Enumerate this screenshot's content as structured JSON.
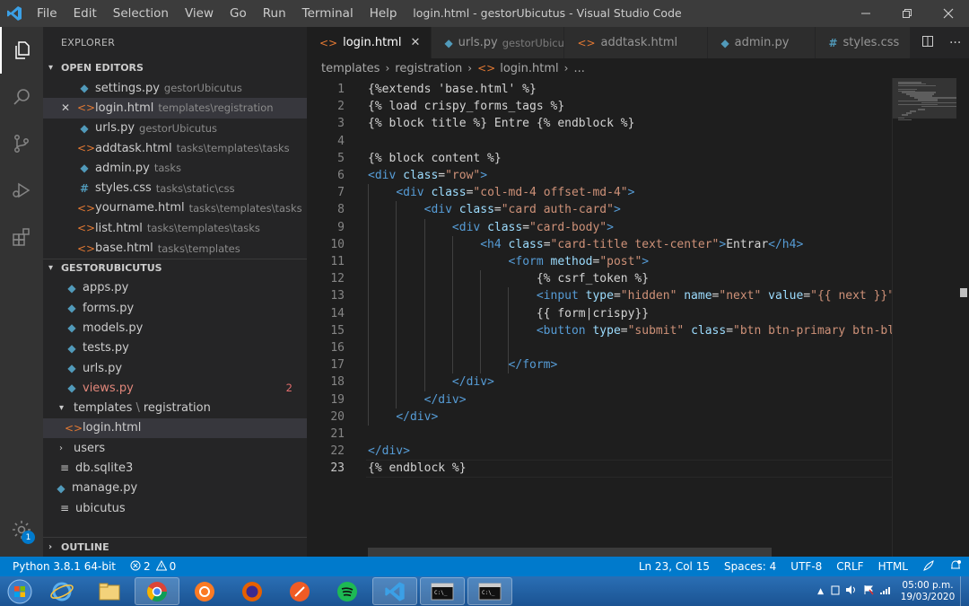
{
  "window": {
    "title": "login.html - gestorUbicutus - Visual Studio Code",
    "menu": [
      "File",
      "Edit",
      "Selection",
      "View",
      "Go",
      "Run",
      "Terminal",
      "Help"
    ]
  },
  "sidebar": {
    "title": "EXPLORER",
    "open_editors_label": "OPEN EDITORS",
    "open_editors": [
      {
        "name": "settings.py",
        "desc": "gestorUbicutus",
        "type": "py"
      },
      {
        "name": "login.html",
        "desc": "templates\\registration",
        "type": "html",
        "active": true
      },
      {
        "name": "urls.py",
        "desc": "gestorUbicutus",
        "type": "py"
      },
      {
        "name": "addtask.html",
        "desc": "tasks\\templates\\tasks",
        "type": "html"
      },
      {
        "name": "admin.py",
        "desc": "tasks",
        "type": "py"
      },
      {
        "name": "styles.css",
        "desc": "tasks\\static\\css",
        "type": "css"
      },
      {
        "name": "yourname.html",
        "desc": "tasks\\templates\\tasks",
        "type": "html"
      },
      {
        "name": "list.html",
        "desc": "tasks\\templates\\tasks",
        "type": "html"
      },
      {
        "name": "base.html",
        "desc": "tasks\\templates",
        "type": "html"
      }
    ],
    "project_label": "GESTORUBICUTUS",
    "tree": {
      "apps": "apps.py",
      "forms": "forms.py",
      "models": "models.py",
      "tests": "tests.py",
      "urls": "urls.py",
      "views": "views.py",
      "views_count": "2",
      "templates_a": "templates",
      "templates_b": "registration",
      "login": "login.html",
      "users": "users",
      "db": "db.sqlite3",
      "manage": "manage.py",
      "ubicutus": "ubicutus"
    },
    "outline_label": "OUTLINE"
  },
  "tabs": [
    {
      "name": "login.html",
      "desc": "",
      "type": "html",
      "active": true
    },
    {
      "name": "urls.py",
      "desc": "gestorUbicutus",
      "type": "py"
    },
    {
      "name": "addtask.html",
      "desc": "",
      "type": "html"
    },
    {
      "name": "admin.py",
      "desc": "",
      "type": "py"
    },
    {
      "name": "styles.css",
      "desc": "",
      "type": "css"
    }
  ],
  "breadcrumb": [
    "templates",
    "registration",
    "login.html",
    "..."
  ],
  "editor": {
    "lines": [
      {
        "n": "1",
        "segs": [
          [
            "tx",
            "{%extends 'base.html' %}"
          ]
        ]
      },
      {
        "n": "2",
        "segs": [
          [
            "tx",
            "{% load crispy_forms_tags %}"
          ]
        ]
      },
      {
        "n": "3",
        "segs": [
          [
            "tx",
            "{% block title %} Entre {% endblock %}"
          ]
        ]
      },
      {
        "n": "4",
        "segs": []
      },
      {
        "n": "5",
        "segs": [
          [
            "tx",
            "{% block content %}"
          ]
        ]
      },
      {
        "n": "6",
        "segs": [
          [
            "tg",
            "<div "
          ],
          [
            "at",
            "class"
          ],
          [
            "tx",
            "="
          ],
          [
            "sv",
            "\"row\""
          ],
          [
            "tg",
            ">"
          ]
        ]
      },
      {
        "n": "7",
        "segs": [
          [
            "tx",
            "    "
          ],
          [
            "tg",
            "<div "
          ],
          [
            "at",
            "class"
          ],
          [
            "tx",
            "="
          ],
          [
            "sv",
            "\"col-md-4 offset-md-4\""
          ],
          [
            "tg",
            ">"
          ]
        ]
      },
      {
        "n": "8",
        "segs": [
          [
            "tx",
            "        "
          ],
          [
            "tg",
            "<div "
          ],
          [
            "at",
            "class"
          ],
          [
            "tx",
            "="
          ],
          [
            "sv",
            "\"card auth-card\""
          ],
          [
            "tg",
            ">"
          ]
        ]
      },
      {
        "n": "9",
        "segs": [
          [
            "tx",
            "            "
          ],
          [
            "tg",
            "<div "
          ],
          [
            "at",
            "class"
          ],
          [
            "tx",
            "="
          ],
          [
            "sv",
            "\"card-body\""
          ],
          [
            "tg",
            ">"
          ]
        ]
      },
      {
        "n": "10",
        "segs": [
          [
            "tx",
            "                "
          ],
          [
            "tg",
            "<h4 "
          ],
          [
            "at",
            "class"
          ],
          [
            "tx",
            "="
          ],
          [
            "sv",
            "\"card-title text-center\""
          ],
          [
            "tg",
            ">"
          ],
          [
            "tx",
            "Entrar"
          ],
          [
            "tg",
            "</h4>"
          ]
        ]
      },
      {
        "n": "11",
        "segs": [
          [
            "tx",
            "                    "
          ],
          [
            "tg",
            "<form "
          ],
          [
            "at",
            "method"
          ],
          [
            "tx",
            "="
          ],
          [
            "sv",
            "\"post\""
          ],
          [
            "tg",
            ">"
          ]
        ]
      },
      {
        "n": "12",
        "segs": [
          [
            "tx",
            "                        {% csrf_token %}"
          ]
        ]
      },
      {
        "n": "13",
        "segs": [
          [
            "tx",
            "                        "
          ],
          [
            "tg",
            "<input "
          ],
          [
            "at",
            "type"
          ],
          [
            "tx",
            "="
          ],
          [
            "sv",
            "\"hidden\""
          ],
          [
            "tx",
            " "
          ],
          [
            "at",
            "name"
          ],
          [
            "tx",
            "="
          ],
          [
            "sv",
            "\"next\""
          ],
          [
            "tx",
            " "
          ],
          [
            "at",
            "value"
          ],
          [
            "tx",
            "="
          ],
          [
            "sv",
            "\"{{ next }}\""
          ]
        ]
      },
      {
        "n": "14",
        "segs": [
          [
            "tx",
            "                        {{ form|crispy}}"
          ]
        ]
      },
      {
        "n": "15",
        "segs": [
          [
            "tx",
            "                        "
          ],
          [
            "tg",
            "<button "
          ],
          [
            "at",
            "type"
          ],
          [
            "tx",
            "="
          ],
          [
            "sv",
            "\"submit\""
          ],
          [
            "tx",
            " "
          ],
          [
            "at",
            "class"
          ],
          [
            "tx",
            "="
          ],
          [
            "sv",
            "\"btn btn-primary btn-bl"
          ]
        ]
      },
      {
        "n": "16",
        "segs": []
      },
      {
        "n": "17",
        "segs": [
          [
            "tx",
            "                    "
          ],
          [
            "tg",
            "</form>"
          ]
        ]
      },
      {
        "n": "18",
        "segs": [
          [
            "tx",
            "            "
          ],
          [
            "tg",
            "</div>"
          ]
        ]
      },
      {
        "n": "19",
        "segs": [
          [
            "tx",
            "        "
          ],
          [
            "tg",
            "</div>"
          ]
        ]
      },
      {
        "n": "20",
        "segs": [
          [
            "tx",
            "    "
          ],
          [
            "tg",
            "</div>"
          ]
        ]
      },
      {
        "n": "21",
        "segs": []
      },
      {
        "n": "22",
        "segs": [
          [
            "tg",
            "</div>"
          ]
        ]
      },
      {
        "n": "23",
        "segs": [
          [
            "tx",
            "{% endblock %}"
          ]
        ]
      }
    ]
  },
  "statusbar": {
    "python": "Python 3.8.1 64-bit",
    "errors": "2",
    "warnings": "0",
    "position": "Ln 23, Col 15",
    "spaces": "Spaces: 4",
    "encoding": "UTF-8",
    "eol": "CRLF",
    "language": "HTML"
  },
  "taskbar": {
    "time": "05:00 p.m.",
    "date": "19/03/2020"
  },
  "colors": {
    "accent": "#007acc",
    "titlebar": "#3c3c3c",
    "sidebar": "#252526",
    "editor": "#1e1e1e"
  }
}
